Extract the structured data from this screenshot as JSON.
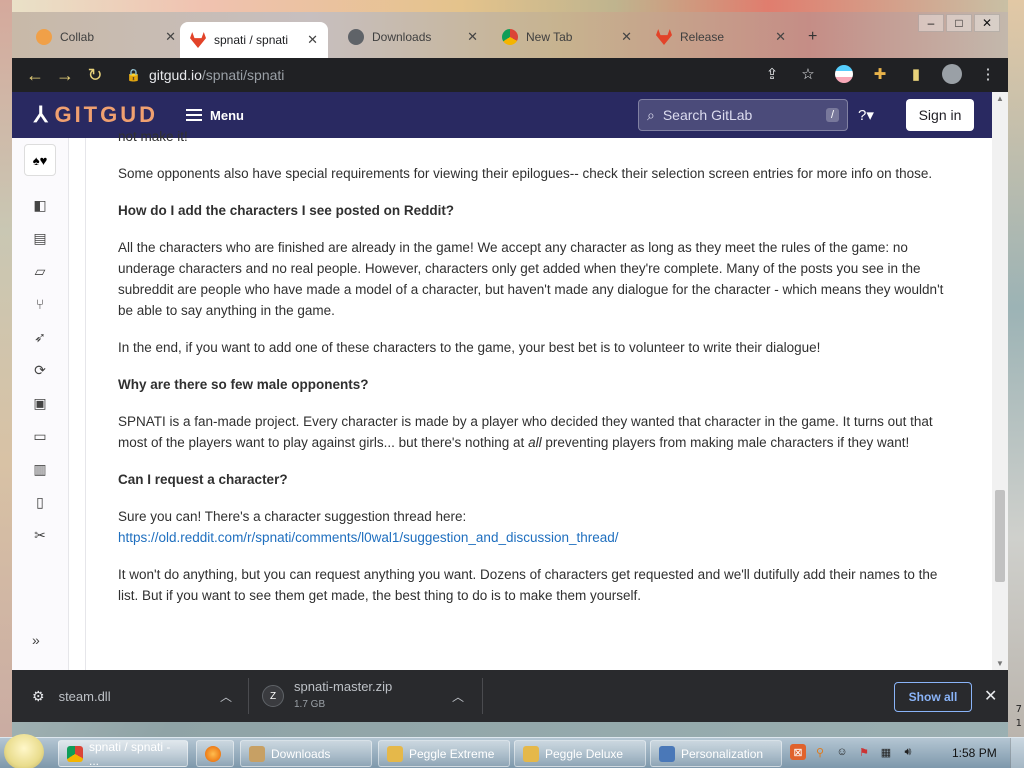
{
  "browser": {
    "tabs": [
      {
        "label": "Collab",
        "favicon": "yellow-tab-icon"
      },
      {
        "label": "spnati / spnati",
        "favicon": "gitlab-icon",
        "active": true
      },
      {
        "label": "Downloads",
        "favicon": "download-icon"
      },
      {
        "label": "New Tab",
        "favicon": "chrome-icon"
      },
      {
        "label": "Release",
        "favicon": "gitlab-icon"
      }
    ],
    "url_host": "gitgud.io",
    "url_path": "/spnati/spnati"
  },
  "gitlab": {
    "logo_text": "GITGUD",
    "menu_label": "Menu",
    "search_placeholder": "Search GitLab",
    "search_shortcut": "/",
    "signin_label": "Sign in"
  },
  "content": {
    "clipped_top": "not make it!",
    "p1": "Some opponents also have special requirements for viewing their epilogues-- check their selection screen entries for more info on those.",
    "h1": "How do I add the characters I see posted on Reddit?",
    "p2": "All the characters who are finished are already in the game! We accept any character as long as they meet the rules of the game: no underage characters and no real people. However, characters only get added when they're complete. Many of the posts you see in the subreddit are people who have made a model of a character, but haven't made any dialogue for the character - which means they wouldn't be able to say anything in the game.",
    "p3": "In the end, if you want to add one of these characters to the game, your best bet is to volunteer to write their dialogue!",
    "h2": "Why are there so few male opponents?",
    "p4_a": "SPNATI is a fan-made project. Every character is made by a player who decided they wanted that character in the game. It turns out that most of the players want to play against girls... but there's nothing at ",
    "p4_em": "all",
    "p4_b": " preventing players from making male characters if they want!",
    "h3": "Can I request a character?",
    "p5": "Sure you can! There's a character suggestion thread here:",
    "link": "https://old.reddit.com/r/spnati/comments/l0wal1/suggestion_and_discussion_thread/",
    "p6": "It won't do anything, but you can request anything you want. Dozens of characters get requested and we'll dutifully add their names to the list. But if you want to see them get made, the best thing to do is to make them yourself."
  },
  "downloads": {
    "items": [
      {
        "name": "steam.dll",
        "size": ""
      },
      {
        "name": "spnati-master.zip",
        "size": "1.7 GB"
      }
    ],
    "show_all": "Show all"
  },
  "taskbar": {
    "items": [
      {
        "label": "spnati / spnati - ...",
        "icon": "chrome-icon"
      },
      {
        "label": "",
        "icon": "firefox-icon"
      },
      {
        "label": "Downloads",
        "icon": "folder-icon"
      },
      {
        "label": "Peggle Extreme",
        "icon": "peggle-icon"
      },
      {
        "label": "Peggle Deluxe",
        "icon": "peggle-icon"
      },
      {
        "label": "Personalization",
        "icon": "monitor-icon"
      }
    ],
    "clock": "1:58 PM"
  },
  "desktop": {
    "side_text_1": "7",
    "side_text_2": "1"
  },
  "colors": {
    "gitlab_header": "#292961",
    "link": "#1f6fbf",
    "downloads_accent": "#8ab4f8"
  }
}
